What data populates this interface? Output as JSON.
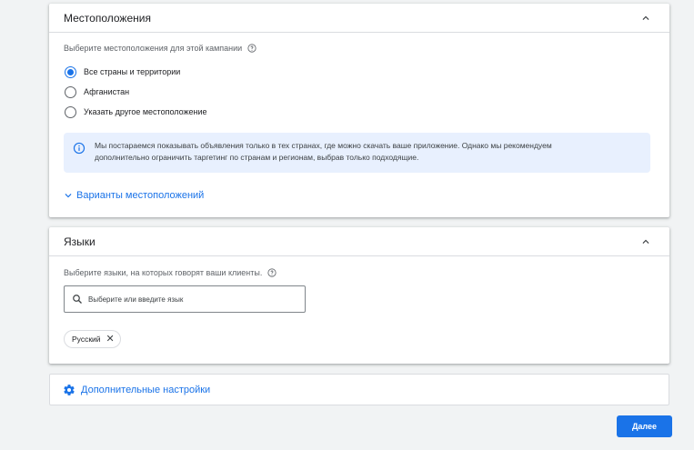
{
  "locations": {
    "title": "Местоположения",
    "prompt": "Выберите местоположения для этой кампании",
    "options": [
      {
        "label": "Все страны и территории",
        "checked": true
      },
      {
        "label": "Афганистан",
        "checked": false
      },
      {
        "label": "Указать другое местоположение",
        "checked": false
      }
    ],
    "info_line1": "Мы постараемся показывать объявления только в тех странах, где можно скачать ваше приложение. Однако мы рекомендуем",
    "info_line2": "дополнительно ограничить таргетинг по странам и регионам, выбрав только подходящие.",
    "variants_link": "Варианты местоположений"
  },
  "languages": {
    "title": "Языки",
    "prompt": "Выберите языки, на которых говорят ваши клиенты.",
    "search_placeholder": "Выберите или введите язык",
    "chip": "Русский"
  },
  "advanced": {
    "label": "Дополнительные настройки"
  },
  "done_button": "Далее",
  "colors": {
    "accent": "#1a73e8",
    "info_bg": "#e8f0fe",
    "page_bg": "#f1f3f4"
  },
  "icons": [
    "chevron-up-icon",
    "help-icon",
    "info-icon",
    "chevron-down-icon",
    "search-icon",
    "close-icon",
    "gear-icon"
  ]
}
